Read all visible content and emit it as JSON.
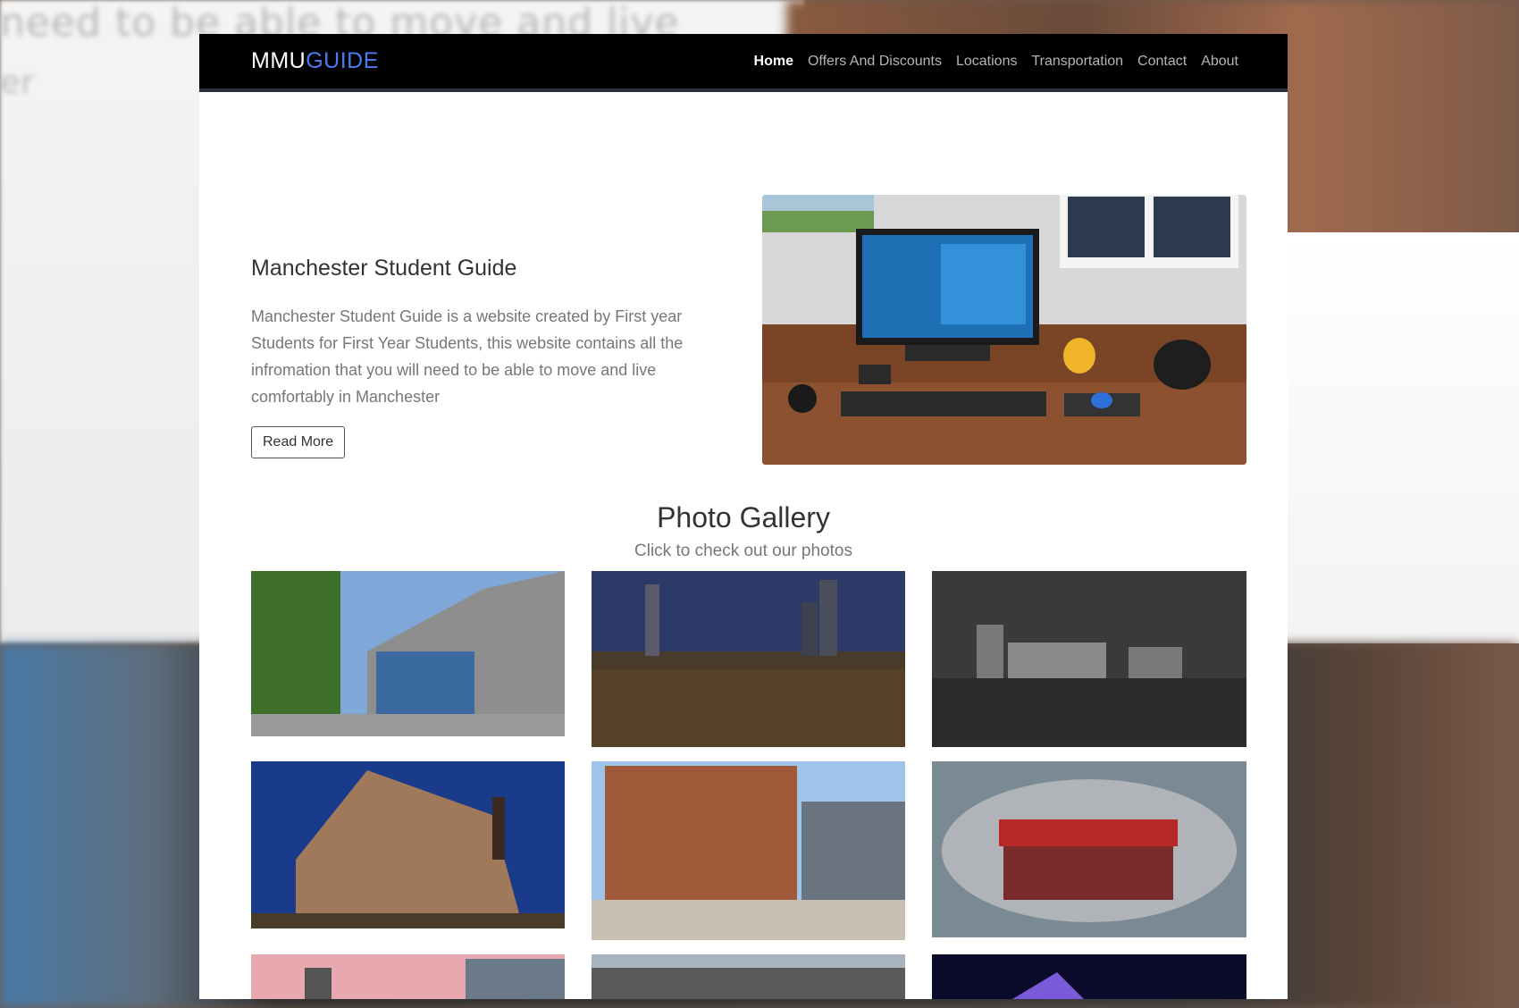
{
  "background_text": {
    "line1": "need to be able to move and live",
    "line2": "er"
  },
  "navbar": {
    "brand_part1": "MMU",
    "brand_part2": "GUIDE",
    "links": [
      {
        "label": "Home",
        "active": true
      },
      {
        "label": "Offers And Discounts",
        "active": false
      },
      {
        "label": "Locations",
        "active": false
      },
      {
        "label": "Transportation",
        "active": false
      },
      {
        "label": "Contact",
        "active": false
      },
      {
        "label": "About",
        "active": false
      }
    ]
  },
  "hero": {
    "title": "Manchester Student Guide",
    "description": "Manchester Student Guide is a website created by First year Students for First Year Students, this website contains all the infromation that you will need to be able to move and live comfortably in Manchester",
    "button_label": "Read More"
  },
  "gallery": {
    "title": "Photo Gallery",
    "subtitle": "Click to check out our photos"
  },
  "colors": {
    "navbar_bg": "#000000",
    "brand_accent": "#4a7cf0",
    "page_bg": "#ffffff"
  }
}
